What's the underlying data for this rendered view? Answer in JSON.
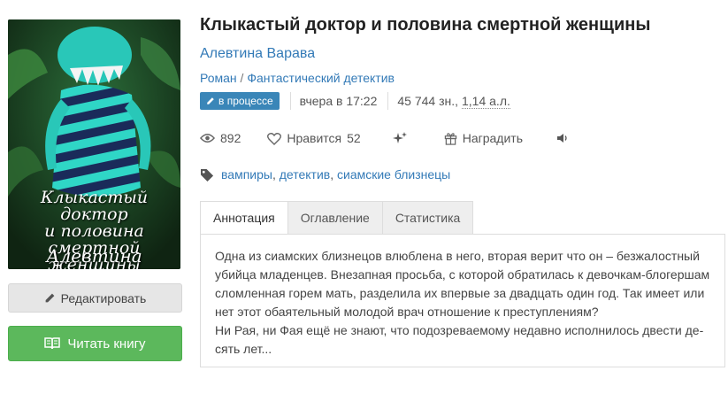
{
  "book": {
    "title": "Клыкастый доктор и половина смертной женщины",
    "author": "Алевтина Варава",
    "genre_main": "Роман",
    "genre_separator": "/",
    "genre_sub": "Фантастический детектив",
    "cover": {
      "title_line1": "Клыкастый доктор",
      "title_line2": "и половина",
      "title_line3": "смертной женщины",
      "author": "Алевтина Варава",
      "colors": {
        "background": "#1b3a1c",
        "accent": "#2fd6c6",
        "stripe_dark": "#15244a"
      }
    }
  },
  "status": {
    "badge_label": "в процессе",
    "badge_icon": "pencil-icon",
    "updated": "вчера в 17:22",
    "size_chars": "45 744 зн.,",
    "size_sheets": "1,14 а.л."
  },
  "stats": {
    "views": "892",
    "likes_label": "Нравится",
    "likes_count": "52",
    "reward_label": "Наградить"
  },
  "tags": {
    "items": [
      "вампиры",
      "детектив",
      "сиамские близнецы"
    ],
    "separator": ","
  },
  "tabs": [
    {
      "label": "Аннотация",
      "active": true
    },
    {
      "label": "Оглавление",
      "active": false
    },
    {
      "label": "Статистика",
      "active": false
    }
  ],
  "annotation": {
    "paragraph1": "Одна из сиамских близнецов влюблена в него, вторая верит что он – безжалостный убийца младенцев. Внезапная просьба, с которой обратилась к девочкам-блогершам сломленная горем мать, разделила их впервые за двадцать один год. Так имеет или нет этот обаятельный молодой врач отношение к преступлениям?",
    "paragraph2": "Ни Рая, ни Фая ещё не знают, что подозреваемому недавно исполнилось двести де-сять лет..."
  },
  "buttons": {
    "edit_label": "Редактировать",
    "read_label": "Читать книгу"
  },
  "colors": {
    "link": "#337ab7",
    "badge": "#3a86b8",
    "read_button": "#5cb85c",
    "edit_button": "#e6e6e6"
  }
}
